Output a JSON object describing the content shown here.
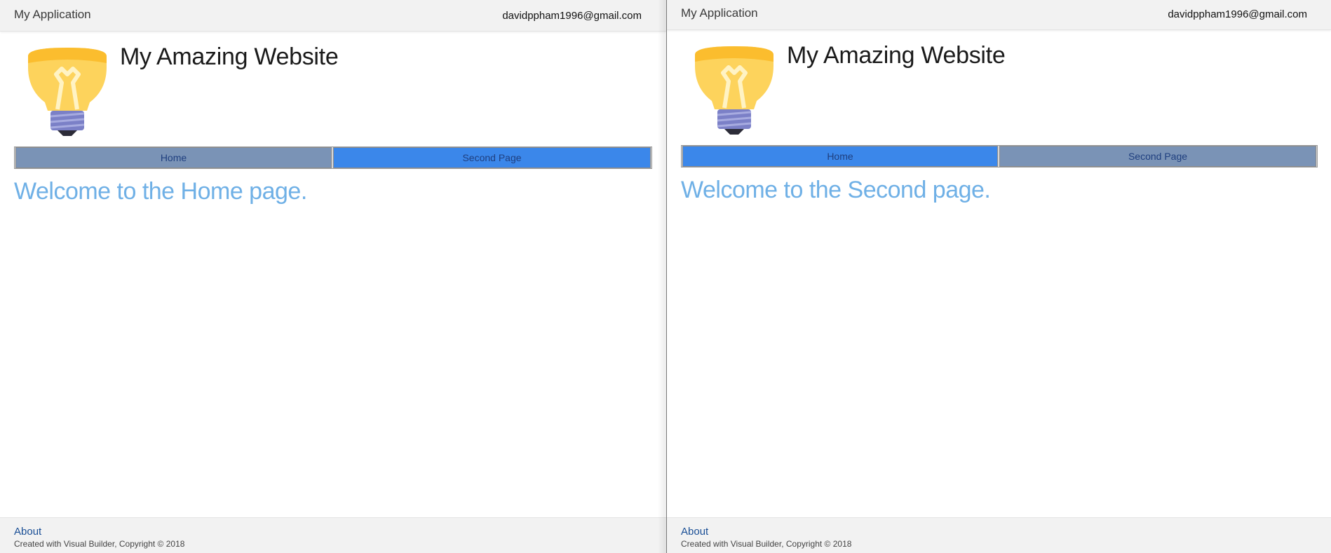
{
  "panels": [
    {
      "app_title": "My Application",
      "user_email": "davidppham1996@gmail.com",
      "site_title": "My Amazing Website",
      "nav": [
        {
          "label": "Home",
          "active": false
        },
        {
          "label": "Second Page",
          "active": true
        }
      ],
      "welcome": "Welcome to the Home page.",
      "footer": {
        "about_link": "About",
        "copyright": "Created with Visual Builder, Copyright © 2018"
      }
    },
    {
      "app_title": "My Application",
      "user_email": "davidppham1996@gmail.com",
      "site_title": "My Amazing Website",
      "nav": [
        {
          "label": "Home",
          "active": true
        },
        {
          "label": "Second Page",
          "active": false
        }
      ],
      "welcome": "Welcome to the Second page.",
      "footer": {
        "about_link": "About",
        "copyright": "Created with Visual Builder, Copyright © 2018"
      }
    }
  ],
  "logo_icon": "lightbulb-icon",
  "colors": {
    "nav_active": "#3b87ea",
    "nav_inactive": "#7a93b6",
    "welcome_text": "#6fb0e6",
    "link": "#1a4f96"
  }
}
